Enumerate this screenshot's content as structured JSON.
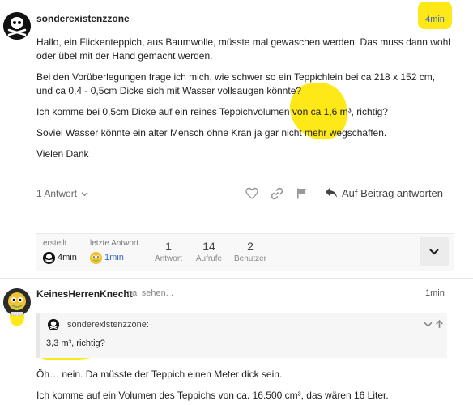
{
  "post1": {
    "username": "sonderexistenzzone",
    "time": "4min",
    "paragraphs": [
      "Hallo, ein Flickenteppich, aus Baumwolle, müsste mal gewaschen werden. Das muss dann wohl oder übel mit der Hand gemacht werden.",
      "Bei den Vorüberlegungen frage ich mich, wie schwer so ein Teppichlein bei ca 218 x 152 cm, und ca 0,4 - 0,5cm Dicke sich mit Wasser vollsaugen könnte?",
      "Ich komme bei 0,5cm Dicke auf ein reines Teppichvolumen von ca 1,6 m³, richtig?",
      "Soviel Wasser könnte ein alter Mensch ohne Kran ja gar nicht mehr wegschaffen.",
      "Vielen Dank"
    ],
    "replies_label": "1 Antwort",
    "reply_label": "Auf Beitrag antworten"
  },
  "topic_map": {
    "created_label": "erstellt",
    "created_time": "4min",
    "last_reply_label": "letzte Antwort",
    "last_reply_time": "1min",
    "stats": [
      {
        "value": "1",
        "label": "Antwort"
      },
      {
        "value": "14",
        "label": "Aufrufe"
      },
      {
        "value": "2",
        "label": "Benutzer"
      }
    ]
  },
  "post2": {
    "username": "KeinesHerrenKnecht",
    "status": "mal sehen. . .",
    "time": "1min",
    "quote": {
      "username": "sonderexistenzzone:",
      "text": "3,3 m³, richtig?"
    },
    "paragraphs": [
      "Öh… nein. Da müsste der Teppich einen Meter dick sein.",
      "Ich komme auf ein Volumen des Teppichs von ca. 16.500 cm³, das wären 16 Liter."
    ]
  },
  "colors": {
    "highlight": "#ffe817",
    "link": "#3a67c4"
  }
}
